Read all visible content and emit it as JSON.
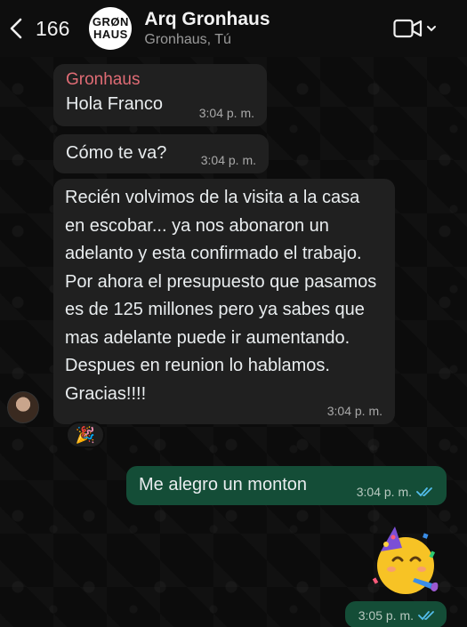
{
  "header": {
    "back_count": "166",
    "avatar_line1": "GRØN",
    "avatar_line2": "HAUS",
    "title": "Arq Gronhaus",
    "subtitle": "Gronhaus, Tú"
  },
  "messages": [
    {
      "sender": "Gronhaus",
      "text": "Hola Franco",
      "time": "3:04 p. m."
    },
    {
      "text": "Cómo te va?",
      "time": "3:04 p. m."
    },
    {
      "text": "Recién volvimos de la visita a la casa en escobar... ya nos abonaron un adelanto y esta confirmado el trabajo. Por ahora el presupuesto que pasamos es de 125 millones pero ya sabes que mas adelante puede ir aumentando. Despues en reunion lo hablamos. Gracias!!!!",
      "time": "3:04 p. m.",
      "reaction": "🎉"
    },
    {
      "text": "Me alegro un monton",
      "time": "3:04 p. m."
    },
    {
      "sticker": "🥳",
      "time": "3:05 p. m."
    }
  ],
  "colors": {
    "incoming_bubble": "#202020",
    "outgoing_bubble": "#144d37",
    "sender_name": "#e06c75",
    "read_ticks": "#53bdeb"
  }
}
